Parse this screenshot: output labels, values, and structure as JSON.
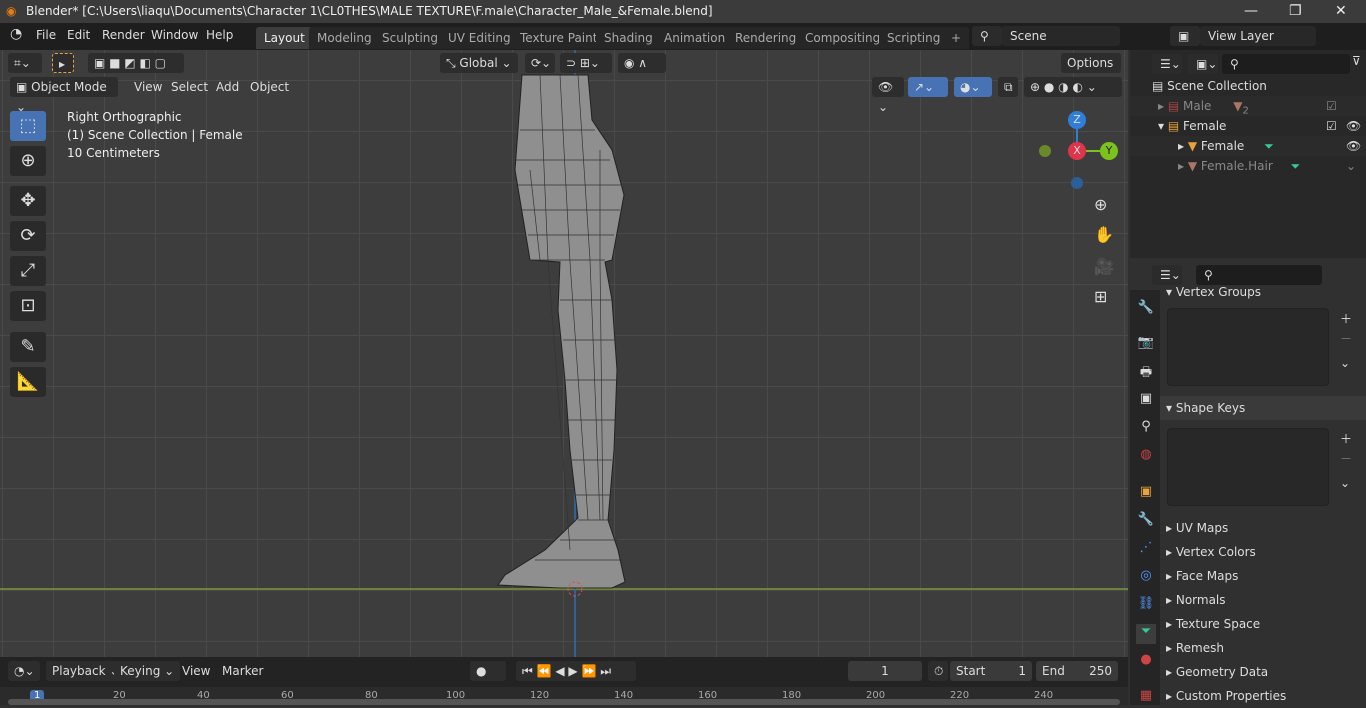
{
  "title": "Blender* [C:\\Users\\liaqu\\Documents\\Character 1\\CL0THES\\MALE TEXTURE\\F.male\\Character_Male_&Female.blend]",
  "menu": [
    "File",
    "Edit",
    "Render",
    "Window",
    "Help"
  ],
  "workspaces": [
    "Layout",
    "Modeling",
    "Sculpting",
    "UV Editing",
    "Texture Paint",
    "Shading",
    "Animation",
    "Rendering",
    "Compositing",
    "Scripting"
  ],
  "scene": "Scene",
  "view_layer": "View Layer",
  "toolbar": {
    "orientation": "Global",
    "options": "Options"
  },
  "viewport_header": {
    "mode": "Object Mode",
    "menus": [
      "View",
      "Select",
      "Add",
      "Object"
    ]
  },
  "overlay": {
    "view": "Right Orthographic",
    "collection": "(1) Scene Collection | Female",
    "scale": "10 Centimeters"
  },
  "gizmo": {
    "z": "Z",
    "x": "X",
    "y": "Y"
  },
  "outliner": {
    "root": "Scene Collection",
    "items": [
      {
        "label": "Male",
        "badge": "2"
      },
      {
        "label": "Female"
      },
      {
        "label": "Female"
      },
      {
        "label": "Female.Hair"
      }
    ]
  },
  "properties": {
    "sections": [
      "Vertex Groups",
      "Shape Keys",
      "UV Maps",
      "Vertex Colors",
      "Face Maps",
      "Normals",
      "Texture Space",
      "Remesh",
      "Geometry Data",
      "Custom Properties"
    ]
  },
  "timeline": {
    "menus": [
      "Playback",
      "Keying",
      "View",
      "Marker"
    ],
    "current_frame": "1",
    "start_label": "Start",
    "start": "1",
    "end_label": "End",
    "end": "250",
    "ticks": [
      "1",
      "20",
      "40",
      "60",
      "80",
      "100",
      "120",
      "140",
      "160",
      "180",
      "200",
      "220",
      "240"
    ]
  }
}
